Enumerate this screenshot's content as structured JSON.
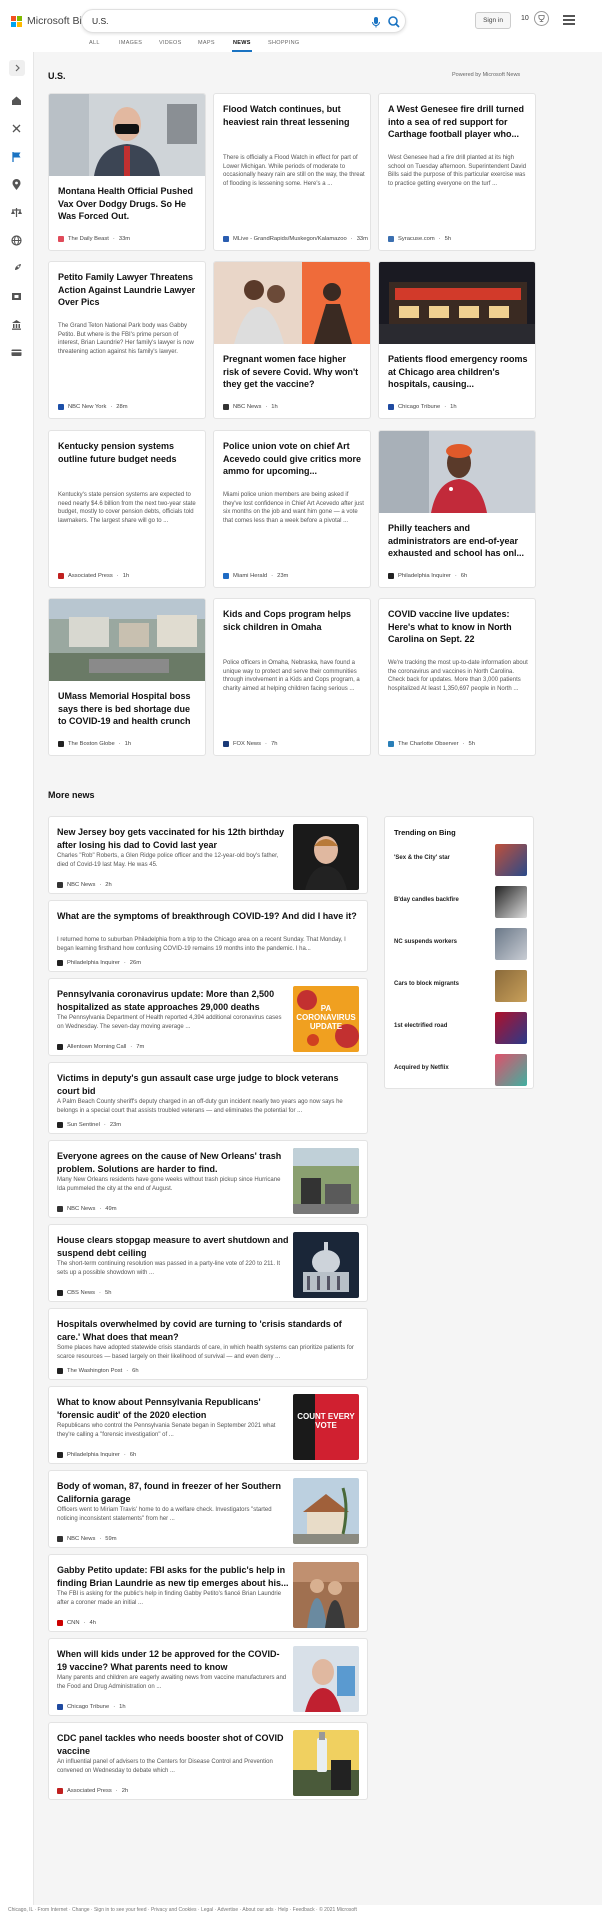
{
  "header": {
    "logo": "Microsoft Bing",
    "search_value": "U.S.",
    "sign_in": "Sign in",
    "points": "10"
  },
  "scopes": [
    "ALL",
    "IMAGES",
    "VIDEOS",
    "MAPS",
    "NEWS",
    "SHOPPING"
  ],
  "rail_icons": [
    "home-icon",
    "sparkle-icon",
    "flag-icon",
    "map-pin-icon",
    "scale-icon",
    "globe-icon",
    "rocket-icon",
    "film-icon",
    "bank-icon",
    "card-icon"
  ],
  "main": {
    "title": "U.S.",
    "powered_by": "Powered by Microsoft News"
  },
  "cards": [
    {
      "title": "Montana Health Official Pushed Vax Over Dodgy Drugs. So He Was Forced Out.",
      "snippet": "",
      "source": "The Daily Beast",
      "age": "33m",
      "has_image": true,
      "img_theme": "man",
      "src_color": "#e04b5a"
    },
    {
      "title": "Flood Watch continues, but heaviest rain threat lessening",
      "snippet": "There is officially a Flood Watch in effect for part of Lower Michigan. While periods of moderate to occasionally heavy rain are still on the way, the threat of flooding is lessening some. Here's a ...",
      "source": "MLive - GrandRapids/Muskegon/Kalamazoo",
      "age": "33m",
      "has_image": false,
      "src_color": "#2a5db0"
    },
    {
      "title": "A West Genesee fire drill turned into a sea of red support for Carthage football player who...",
      "snippet": "West Genesee had a fire drill planted at its high school on Tuesday afternoon. Superintendent David Bills said the purpose of this particular exercise was to practice getting everyone on the turf ...",
      "source": "Syracuse.com",
      "age": "5h",
      "has_image": false,
      "src_color": "#3b6fb0"
    },
    {
      "title": "Petito Family Lawyer Threatens Action Against Laundrie Lawyer Over Pics",
      "snippet": "The Grand Teton National Park body was Gabby Petito. But where is the FBI's prime person of interest, Brian Laundrie? Her family's lawyer is now threatening action against his family's lawyer.",
      "source": "NBC New York",
      "age": "28m",
      "has_image": false,
      "src_color": "#1c4fa8"
    },
    {
      "title": "Pregnant women face higher risk of severe Covid. Why won't they get the vaccine?",
      "snippet": "",
      "source": "NBC News",
      "age": "1h",
      "has_image": true,
      "img_theme": "family",
      "src_color": "#333"
    },
    {
      "title": "Patients flood emergency rooms at Chicago area children's hospitals, causing...",
      "snippet": "",
      "source": "Chicago Tribune",
      "age": "1h",
      "has_image": true,
      "img_theme": "hospital",
      "src_color": "#1f4aa0"
    },
    {
      "title": "Kentucky pension systems outline future budget needs",
      "snippet": "Kentucky's state pension systems are expected to need nearly $4.6 billion from the next two-year state budget, mostly to cover pension debts, officials told lawmakers. The largest share will go to ...",
      "source": "Associated Press",
      "age": "1h",
      "has_image": false,
      "src_color": "#c0201f"
    },
    {
      "title": "Police union vote on chief Art Acevedo could give critics more ammo for upcoming...",
      "snippet": "Miami police union members are being asked if they've lost confidence in Chief Art Acevedo after just six months on the job and want him gone — a vote that comes less than a week before a pivotal ...",
      "source": "Miami Herald",
      "age": "23m",
      "has_image": false,
      "src_color": "#1e6bc4"
    },
    {
      "title": "Philly teachers and administrators are end-of-year exhausted and school has onl...",
      "snippet": "",
      "source": "Philadelphia Inquirer",
      "age": "6h",
      "has_image": true,
      "img_theme": "woman",
      "src_color": "#222"
    },
    {
      "title": "UMass Memorial Hospital boss says there is bed shortage due to COVID-19 and health crunch",
      "snippet": "",
      "source": "The Boston Globe",
      "age": "1h",
      "has_image": true,
      "img_theme": "aerial",
      "src_color": "#222"
    },
    {
      "title": "Kids and Cops program helps sick children in Omaha",
      "snippet": "Police officers in Omaha, Nebraska, have found a unique way to protect and serve their communities through involvement in a Kids and Cops program, a charity aimed at helping children facing serious ...",
      "source": "FOX News",
      "age": "7h",
      "has_image": false,
      "src_color": "#1a3a78"
    },
    {
      "title": "COVID vaccine live updates: Here's what to know in North Carolina on Sept. 22",
      "snippet": "We're tracking the most up-to-date information about the coronavirus and vaccines in North Carolina. Check back for updates. More than 3,000 patients hospitalized At least 1,350,697 people in North ...",
      "source": "The Charlotte Observer",
      "age": "5h",
      "has_image": false,
      "src_color": "#2a7fb8"
    }
  ],
  "more_news": {
    "title": "More news",
    "items": [
      {
        "title": "New Jersey boy gets vaccinated for his 12th birthday after losing his dad to Covid last year",
        "snippet": "Charles \"Rob\" Roberts, a Glen Ridge police officer and the 12-year-old boy's father, died of Covid-19 last May. He was 45.",
        "source": "NBC News",
        "age": "2h",
        "thumb": "boy",
        "src_color": "#333"
      },
      {
        "title": "What are the symptoms of breakthrough COVID-19? And did I have it?",
        "snippet": "I returned home to suburban Philadelphia from a trip to the Chicago area on a recent Sunday. That Monday, I began learning firsthand how confusing COVID-19 remains 19 months into the pandemic. I ha...",
        "source": "Philadelphia Inquirer",
        "age": "26m",
        "thumb": "",
        "src_color": "#222"
      },
      {
        "title": "Pennsylvania coronavirus update: More than 2,500 hospitalized as state approaches 29,000 deaths",
        "snippet": "The Pennsylvania Department of Health reported 4,394 additional coronavirus cases on Wednesday. The seven-day moving average ...",
        "source": "Allentown Morning Call",
        "age": "7m",
        "thumb": "pa",
        "thumb_text": "PA CORONAVIRUS UPDATE",
        "src_color": "#222"
      },
      {
        "title": "Victims in deputy's gun assault case urge judge to block veterans court bid",
        "snippet": "A Palm Beach County sheriff's deputy charged in an off-duty gun incident nearly two years ago now says he belongs in a special court that assists troubled veterans — and eliminates the potential for ...",
        "source": "Sun Sentinel",
        "age": "23m",
        "thumb": "",
        "src_color": "#222"
      },
      {
        "title": "Everyone agrees on the cause of New Orleans' trash problem. Solutions are harder to find.",
        "snippet": "Many New Orleans residents have gone weeks without trash pickup since Hurricane Ida pummeled the city at the end of August.",
        "source": "NBC News",
        "age": "49m",
        "thumb": "trash",
        "src_color": "#333"
      },
      {
        "title": "House clears stopgap measure to avert shutdown and suspend debt ceiling",
        "snippet": "The short-term continuing resolution was passed in a party-line vote of 220 to 211. It sets up a possible showdown with ...",
        "source": "CBS News",
        "age": "5h",
        "thumb": "capitol",
        "src_color": "#222"
      },
      {
        "title": "Hospitals overwhelmed by covid are turning to 'crisis standards of care.' What does that mean?",
        "snippet": "Some places have adopted statewide crisis standards of care, in which health systems can prioritize patients for scarce resources — based largely on their likelihood of survival — and even deny ...",
        "source": "The Washington Post",
        "age": "6h",
        "thumb": "",
        "src_color": "#222"
      },
      {
        "title": "What to know about Pennsylvania Republicans' 'forensic audit' of the 2020 election",
        "snippet": "Republicans who control the Pennsylvania Senate began in September 2021 what they're calling a \"forensic investigation\" of ...",
        "source": "Philadelphia Inquirer",
        "age": "6h",
        "thumb": "vote",
        "thumb_text": "COUNT EVERY VOTE",
        "src_color": "#222"
      },
      {
        "title": "Body of woman, 87, found in freezer of her Southern California garage",
        "snippet": "Officers went to Miriam Travis' home to do a welfare check. Investigators \"started noticing inconsistent statements\" from her ...",
        "source": "NBC News",
        "age": "59m",
        "thumb": "house",
        "src_color": "#333"
      },
      {
        "title": "Gabby Petito update: FBI asks for the public's help in finding Brian Laundrie as new tip emerges about his...",
        "snippet": "The FBI is asking for the public's help in finding Gabby Petito's fiancé Brian Laundrie after a coroner made an initial ...",
        "source": "CNN",
        "age": "4h",
        "thumb": "couple",
        "src_color": "#cc0000"
      },
      {
        "title": "When will kids under 12 be approved for the COVID-19 vaccine? What parents need to know",
        "snippet": "Many parents and children are eagerly awaiting news from vaccine manufacturers and the Food and Drug Administration on ...",
        "source": "Chicago Tribune",
        "age": "1h",
        "thumb": "kid",
        "src_color": "#1f4aa0"
      },
      {
        "title": "CDC panel tackles who needs booster shot of COVID vaccine",
        "snippet": "An influential panel of advisers to the Centers for Disease Control and Prevention convened on Wednesday to debate which ...",
        "source": "Associated Press",
        "age": "2h",
        "thumb": "vaccine",
        "src_color": "#c0201f"
      }
    ]
  },
  "trending": {
    "title": "Trending on Bing",
    "items": [
      {
        "label": "'Sex & the City' star",
        "colors": [
          "#c0503a",
          "#2a4a8a"
        ]
      },
      {
        "label": "B'day candles backfire",
        "colors": [
          "#222",
          "#ddd"
        ]
      },
      {
        "label": "NC suspends workers",
        "colors": [
          "#6a7888",
          "#c9cdd4"
        ]
      },
      {
        "label": "Cars to block migrants",
        "colors": [
          "#8a6a3a",
          "#c9a05a"
        ]
      },
      {
        "label": "1st electrified road",
        "colors": [
          "#b0102a",
          "#2a3a8a"
        ]
      },
      {
        "label": "Acquired by Netflix",
        "colors": [
          "#e0506a",
          "#40b0a0"
        ]
      }
    ]
  },
  "footer": {
    "text": "Chicago, IL · From Internet · Change · Sign in to see your feed · Privacy and Cookies · Legal · Advertise · About our ads · Help · Feedback · © 2021 Microsoft"
  }
}
